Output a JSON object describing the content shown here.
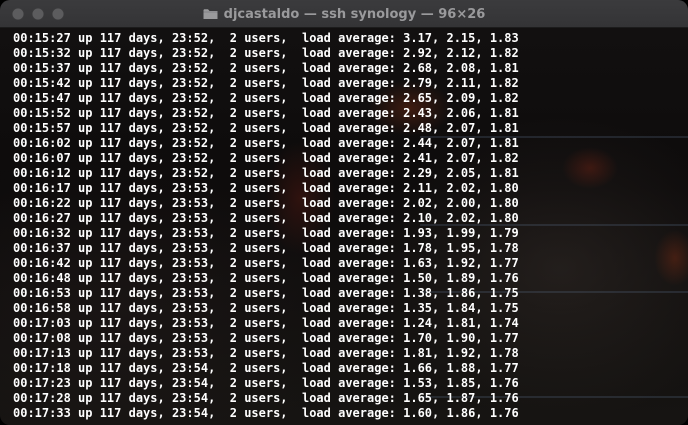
{
  "window": {
    "title": "djcastaldo — ssh synology — 96×26"
  },
  "terminal": {
    "lines": [
      "00:15:27 up 117 days, 23:52,  2 users,  load average: 3.17, 2.15, 1.83",
      "00:15:32 up 117 days, 23:52,  2 users,  load average: 2.92, 2.12, 1.82",
      "00:15:37 up 117 days, 23:52,  2 users,  load average: 2.68, 2.08, 1.81",
      "00:15:42 up 117 days, 23:52,  2 users,  load average: 2.79, 2.11, 1.82",
      "00:15:47 up 117 days, 23:52,  2 users,  load average: 2.65, 2.09, 1.82",
      "00:15:52 up 117 days, 23:52,  2 users,  load average: 2.43, 2.06, 1.81",
      "00:15:57 up 117 days, 23:52,  2 users,  load average: 2.48, 2.07, 1.81",
      "00:16:02 up 117 days, 23:52,  2 users,  load average: 2.44, 2.07, 1.81",
      "00:16:07 up 117 days, 23:52,  2 users,  load average: 2.41, 2.07, 1.82",
      "00:16:12 up 117 days, 23:52,  2 users,  load average: 2.29, 2.05, 1.81",
      "00:16:17 up 117 days, 23:53,  2 users,  load average: 2.11, 2.02, 1.80",
      "00:16:22 up 117 days, 23:53,  2 users,  load average: 2.02, 2.00, 1.80",
      "00:16:27 up 117 days, 23:53,  2 users,  load average: 2.10, 2.02, 1.80",
      "00:16:32 up 117 days, 23:53,  2 users,  load average: 1.93, 1.99, 1.79",
      "00:16:37 up 117 days, 23:53,  2 users,  load average: 1.78, 1.95, 1.78",
      "00:16:42 up 117 days, 23:53,  2 users,  load average: 1.63, 1.92, 1.77",
      "00:16:48 up 117 days, 23:53,  2 users,  load average: 1.50, 1.89, 1.76",
      "00:16:53 up 117 days, 23:53,  2 users,  load average: 1.38, 1.86, 1.75",
      "00:16:58 up 117 days, 23:53,  2 users,  load average: 1.35, 1.84, 1.75",
      "00:17:03 up 117 days, 23:53,  2 users,  load average: 1.24, 1.81, 1.74",
      "00:17:08 up 117 days, 23:53,  2 users,  load average: 1.70, 1.90, 1.77",
      "00:17:13 up 117 days, 23:53,  2 users,  load average: 1.81, 1.92, 1.78",
      "00:17:18 up 117 days, 23:54,  2 users,  load average: 1.66, 1.88, 1.77",
      "00:17:23 up 117 days, 23:54,  2 users,  load average: 1.53, 1.85, 1.76",
      "00:17:28 up 117 days, 23:54,  2 users,  load average: 1.65, 1.87, 1.76",
      "00:17:33 up 117 days, 23:54,  2 users,  load average: 1.60, 1.86, 1.76"
    ]
  },
  "icons": {
    "title_icon": "folder-icon",
    "window_controls": [
      "close-button-icon",
      "minimize-button-icon",
      "zoom-button-icon"
    ]
  },
  "colors": {
    "text": "#ffffff",
    "titlebar": "#3a3a3c",
    "title_text": "#9a9a9c",
    "inactive_traffic_light": "#5c5c5e"
  }
}
